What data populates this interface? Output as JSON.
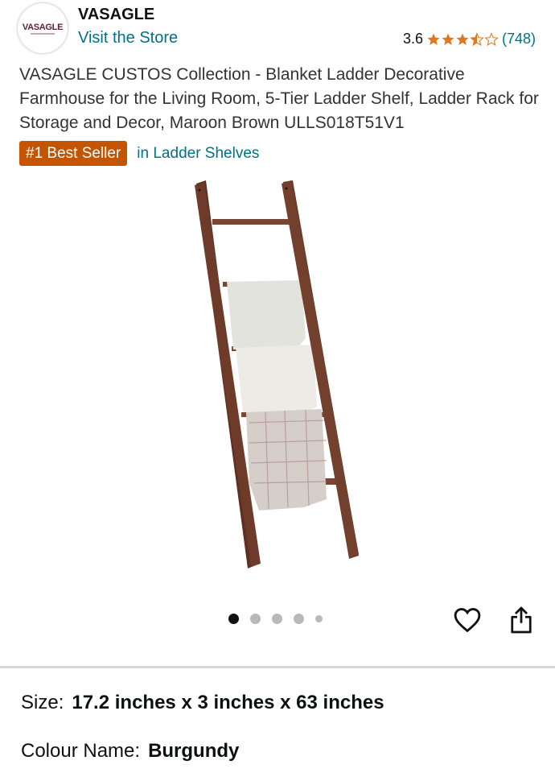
{
  "store": {
    "logo_text": "VASAGLE",
    "brand_name": "VASAGLE",
    "visit_store_label": "Visit the Store"
  },
  "rating": {
    "value": "3.6",
    "stars_out_of_5": 3.5,
    "count": "(748)",
    "star_color": "#de7921"
  },
  "product": {
    "title": "VASAGLE CUSTOS Collection - Blanket Ladder Decorative Farmhouse for the Living Room, 5-Tier Ladder Shelf, Ladder Rack for Storage and Decor, Maroon Brown ULLS018T51V1"
  },
  "badge": {
    "label": "#1 Best Seller",
    "category": "in Ladder Shelves",
    "color": "#c45500"
  },
  "gallery": {
    "image_icon": "blanket-ladder-image",
    "image_count": 5,
    "active_index": 0
  },
  "actions": {
    "wishlist_icon": "heart-icon",
    "share_icon": "share-icon"
  },
  "attributes": {
    "size_label": "Size:",
    "size_value": "17.2 inches x 3 inches x 63 inches",
    "colour_label": "Colour Name:",
    "colour_value": "Burgundy"
  },
  "colors": {
    "link": "#007185",
    "ladder_wood": "#6b3a2a"
  }
}
